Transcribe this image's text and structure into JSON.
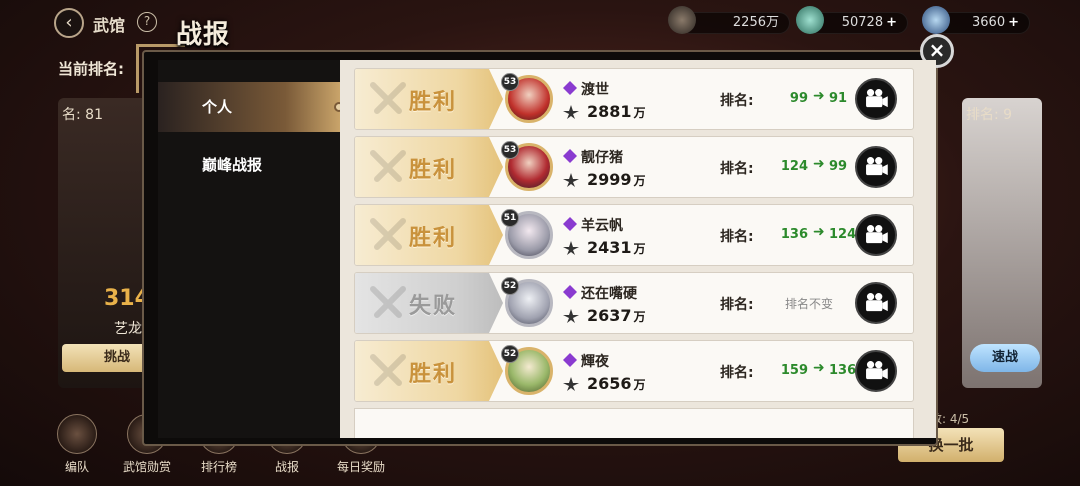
{
  "topbar": {
    "back_icon": "back-arrow-icon",
    "title": "武馆",
    "help": "?",
    "resources": [
      {
        "icon": "power-emblem-icon",
        "value": "2256万",
        "plus": ""
      },
      {
        "icon": "jade-icon",
        "value": "50728",
        "plus": "+"
      },
      {
        "icon": "crystal-icon",
        "value": "3660",
        "plus": "+"
      }
    ]
  },
  "background": {
    "current_rank_label": "当前排名:",
    "left_card": {
      "rank": "名: 81",
      "score": "314",
      "name": "艺龙",
      "button": "挑战"
    },
    "right_card": {
      "rank": "排名: 9",
      "button": "速战"
    },
    "count_label": "数: 4/5",
    "refresh_button": "换一批"
  },
  "bottom_nav": [
    {
      "label": "编队",
      "icon": "formation-icon"
    },
    {
      "label": "武馆勋赏",
      "icon": "reward-icon"
    },
    {
      "label": "排行榜",
      "icon": "leaderboard-icon"
    },
    {
      "label": "战报",
      "icon": "report-icon"
    },
    {
      "label": "每日奖励",
      "icon": "daily-reward-icon"
    }
  ],
  "modal": {
    "title": "战报",
    "close": "×",
    "tabs": [
      {
        "label": "个人",
        "active": true
      },
      {
        "label": "巅峰战报",
        "active": false
      }
    ],
    "rank_label": "排名:",
    "unit": "万",
    "records": [
      {
        "result": "胜利",
        "outcome": "win",
        "level": "53",
        "name": "渡世",
        "power": "2881",
        "rank_from": "99",
        "rank_to": "91"
      },
      {
        "result": "胜利",
        "outcome": "win",
        "level": "53",
        "name": "靓仔猪",
        "power": "2999",
        "rank_from": "124",
        "rank_to": "99"
      },
      {
        "result": "胜利",
        "outcome": "win",
        "level": "51",
        "name": "羊云帆",
        "power": "2431",
        "rank_from": "136",
        "rank_to": "124"
      },
      {
        "result": "失败",
        "outcome": "lose",
        "level": "52",
        "name": "还在嘴硬",
        "power": "2637",
        "rank_same": "排名不变"
      },
      {
        "result": "胜利",
        "outcome": "win",
        "level": "52",
        "name": "輝夜",
        "power": "2656",
        "rank_from": "159",
        "rank_to": "136"
      }
    ]
  }
}
